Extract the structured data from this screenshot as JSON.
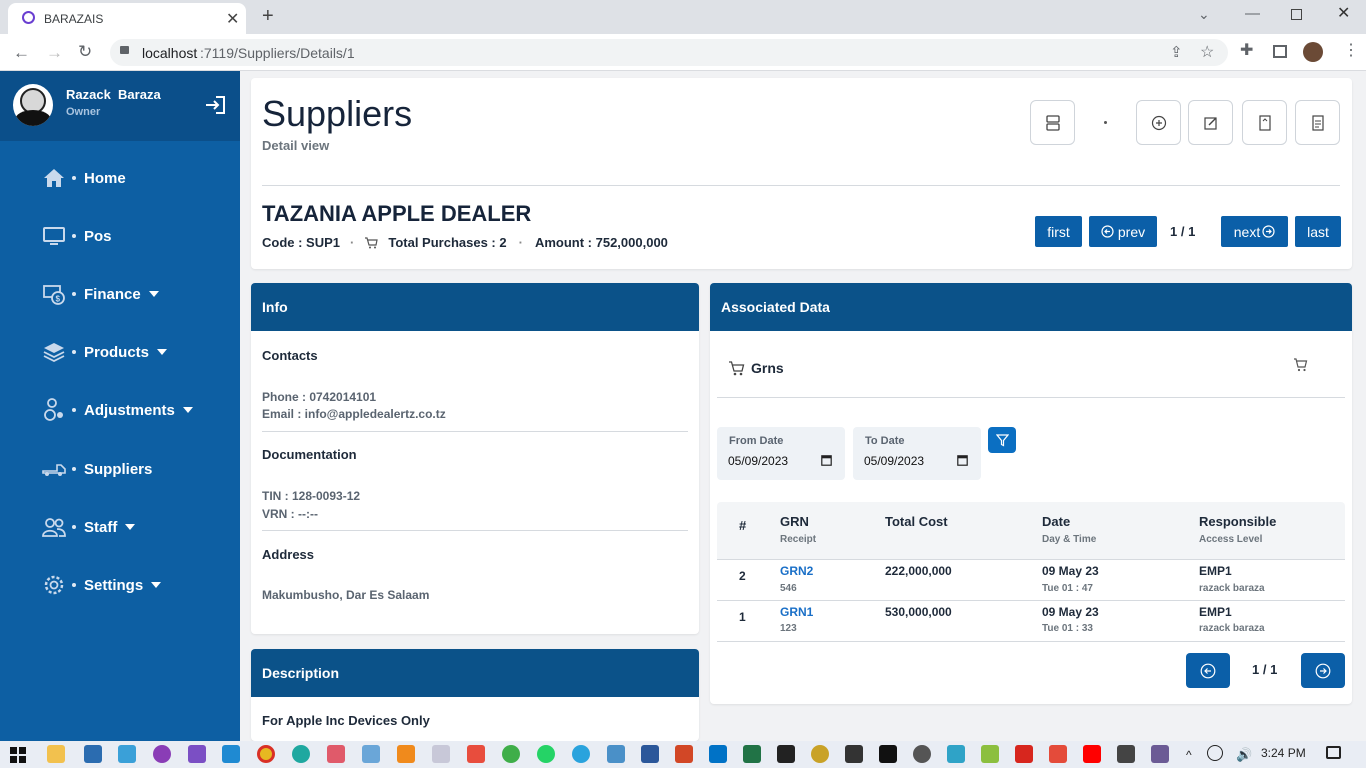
{
  "browser": {
    "tab_title": "BARAZAIS",
    "url_host": "localhost",
    "url_rest": ":7119/Suppliers/Details/1"
  },
  "user": {
    "name": "Razack  Baraza",
    "role": "Owner"
  },
  "sidebar": {
    "items": [
      {
        "label": "Home",
        "icon": "home-icon",
        "dropdown": false
      },
      {
        "label": "Pos",
        "icon": "monitor-icon",
        "dropdown": false
      },
      {
        "label": "Finance",
        "icon": "finance-icon",
        "dropdown": true
      },
      {
        "label": "Products",
        "icon": "layers-icon",
        "dropdown": true
      },
      {
        "label": "Adjustments",
        "icon": "adjustments-icon",
        "dropdown": true
      },
      {
        "label": "Suppliers",
        "icon": "truck-icon",
        "dropdown": false
      },
      {
        "label": "Staff",
        "icon": "users-icon",
        "dropdown": true
      },
      {
        "label": "Settings",
        "icon": "gear-icon",
        "dropdown": true
      }
    ]
  },
  "header": {
    "title": "Suppliers",
    "subtitle": "Detail view"
  },
  "supplier": {
    "name": "TAZANIA APPLE DEALER",
    "code": "Code : SUP1",
    "total_purchases": "Total Purchases : 2",
    "amount": "Amount : 752,000,000"
  },
  "pager": {
    "first": "first",
    "prev": "prev",
    "page": "1 / 1",
    "next": "next",
    "last": "last"
  },
  "info": {
    "heading": "Info",
    "contacts_title": "Contacts",
    "phone": "Phone : 0742014101",
    "email": "Email : info@appledealertz.co.tz",
    "documentation_title": "Documentation",
    "tin": "TIN : 128-0093-12",
    "vrn": "VRN : --:--",
    "address_title": "Address",
    "address": "Makumbusho, Dar Es Salaam"
  },
  "description": {
    "heading": "Description",
    "text": "For Apple Inc Devices Only"
  },
  "associated": {
    "heading": "Associated Data",
    "section": "Grns",
    "from_label": "From Date",
    "from_value": "05/09/2023",
    "to_label": "To Date",
    "to_value": "05/09/2023",
    "columns": [
      {
        "title": "#",
        "sub": ""
      },
      {
        "title": "GRN",
        "sub": "Receipt"
      },
      {
        "title": "Total Cost",
        "sub": ""
      },
      {
        "title": "Date",
        "sub": "Day & Time"
      },
      {
        "title": "Responsible",
        "sub": "Access Level"
      }
    ],
    "rows": [
      {
        "num": "2",
        "grn": "GRN2",
        "receipt": "546",
        "cost": "222,000,000",
        "date": "09 May 23",
        "time": "Tue 01 : 47",
        "emp": "EMP1",
        "level": "razack baraza"
      },
      {
        "num": "1",
        "grn": "GRN1",
        "receipt": "123",
        "cost": "530,000,000",
        "date": "09 May 23",
        "time": "Tue 01 : 33",
        "emp": "EMP1",
        "level": "razack baraza"
      }
    ],
    "page": "1 / 1"
  },
  "taskbar": {
    "time": "3:24 PM"
  },
  "colors": {
    "sidebar": "#0d5fa3",
    "header_bar": "#0b5289",
    "button": "#0b5fa8",
    "link": "#1a6fc7"
  }
}
